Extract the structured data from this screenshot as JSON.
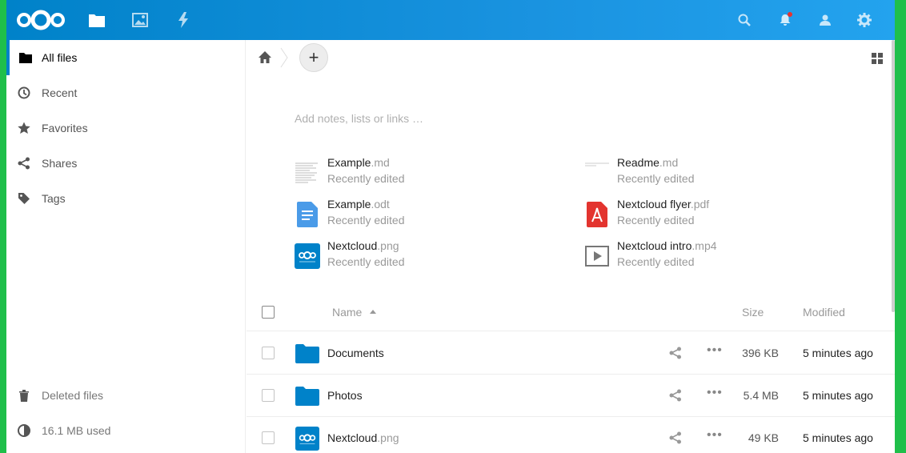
{
  "header": {
    "apps": [
      {
        "icon": "files-folder-icon",
        "active": true
      },
      {
        "icon": "gallery-image-icon",
        "active": false
      },
      {
        "icon": "activity-bolt-icon",
        "active": false
      }
    ],
    "right_icons": [
      "search-icon",
      "notifications-bell-icon",
      "contacts-icon",
      "settings-gear-icon"
    ],
    "brand_color": "#0082c9"
  },
  "sidebar": {
    "items": [
      {
        "label": "All files",
        "icon": "folder-icon",
        "active": true
      },
      {
        "label": "Recent",
        "icon": "clock-icon"
      },
      {
        "label": "Favorites",
        "icon": "star-icon"
      },
      {
        "label": "Shares",
        "icon": "share-icon"
      },
      {
        "label": "Tags",
        "icon": "tag-icon"
      }
    ],
    "deleted_label": "Deleted files",
    "quota_label": "16.1 MB used"
  },
  "main": {
    "notes_placeholder": "Add notes, lists or links …",
    "add_label": "+",
    "recent": [
      {
        "base": "Example",
        "ext": ".md",
        "sub": "Recently edited",
        "icon": "text-preview-icon"
      },
      {
        "base": "Readme",
        "ext": ".md",
        "sub": "Recently edited",
        "icon": "text-preview-icon"
      },
      {
        "base": "Example",
        "ext": ".odt",
        "sub": "Recently edited",
        "icon": "document-icon"
      },
      {
        "base": "Nextcloud flyer",
        "ext": ".pdf",
        "sub": "Recently edited",
        "icon": "pdf-icon"
      },
      {
        "base": "Nextcloud",
        "ext": ".png",
        "sub": "Recently edited",
        "icon": "nextcloud-image-icon"
      },
      {
        "base": "Nextcloud intro",
        "ext": ".mp4",
        "sub": "Recently edited",
        "icon": "video-icon"
      }
    ],
    "table": {
      "headers": {
        "name": "Name",
        "size": "Size",
        "modified": "Modified"
      },
      "rows": [
        {
          "base": "Documents",
          "ext": "",
          "size": "396 KB",
          "modified": "5 minutes ago",
          "icon": "folder-icon"
        },
        {
          "base": "Photos",
          "ext": "",
          "size": "5.4 MB",
          "modified": "5 minutes ago",
          "icon": "folder-icon"
        },
        {
          "base": "Nextcloud",
          "ext": ".png",
          "size": "49 KB",
          "modified": "5 minutes ago",
          "icon": "nextcloud-image-icon"
        }
      ]
    }
  }
}
